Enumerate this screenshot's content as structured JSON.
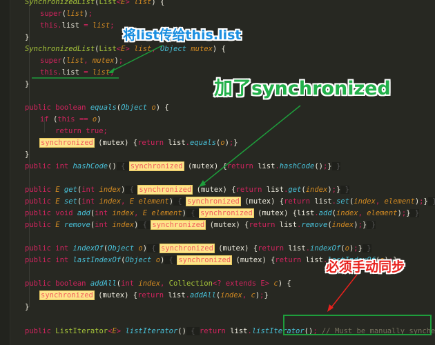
{
  "code": {
    "ctor1": {
      "name": "SynchronizedList",
      "param_type": "List",
      "generic": "E",
      "param": "list"
    },
    "ctor1_super": {
      "kw": "super",
      "arg": "list"
    },
    "ctor1_assign": {
      "this": "this",
      "field": "list",
      "value": "list"
    },
    "ctor2": {
      "name": "SynchronizedList",
      "param_type": "List",
      "generic": "E",
      "param1": "list",
      "param2_type": "Object",
      "param2": "mutex"
    },
    "ctor2_super": {
      "kw": "super",
      "arg1": "list",
      "arg2": "mutex"
    },
    "ctor2_assign": {
      "this": "this",
      "field": "list",
      "value": "list"
    },
    "equals": {
      "mods": "public boolean",
      "name": "equals",
      "ptype": "Object",
      "param": "o"
    },
    "equals_if": {
      "kw": "if",
      "this": "this",
      "op": "==",
      "param": "o"
    },
    "equals_return": "return true;",
    "sync_kw": "synchronized",
    "mutex": "mutex",
    "return_kw": "return",
    "list_ref": "list",
    "hashcode": {
      "mods": "public int",
      "name": "hashCode"
    },
    "get": {
      "mods": "public",
      "ret": "E",
      "name": "get",
      "ptype": "int",
      "param": "index"
    },
    "set": {
      "mods": "public",
      "ret": "E",
      "name": "set",
      "ptype": "int",
      "param": "index",
      "ptype2": "E",
      "param2": "element"
    },
    "add": {
      "mods": "public void",
      "name": "add",
      "ptype": "int",
      "param": "index",
      "ptype2": "E",
      "param2": "element"
    },
    "remove": {
      "mods": "public",
      "ret": "E",
      "name": "remove",
      "ptype": "int",
      "param": "index"
    },
    "indexof": {
      "mods": "public int",
      "name": "indexOf",
      "ptype": "Object",
      "param": "o"
    },
    "lastindexof": {
      "mods": "public int",
      "name": "lastIndexOf",
      "ptype": "Object",
      "param": "o"
    },
    "addall": {
      "mods": "public boolean",
      "name": "addAll",
      "ptype": "int",
      "param": "index",
      "ptype2": "Collection",
      "generic": "? extends E",
      "param2": "c"
    },
    "listiterator": {
      "mods": "public",
      "ret": "ListIterator",
      "generic": "E",
      "name": "listIterator",
      "comment": "// Must be manually synched by user"
    }
  },
  "annotations": {
    "blue": "将list传给this.list",
    "green": "加了synchronized",
    "red": "必须手动同步"
  },
  "colors": {
    "background": "#272822",
    "highlight": "#fde58a",
    "annotation_blue": "#1b8fe0",
    "annotation_green": "#22b04a",
    "annotation_red": "#e8211d"
  }
}
